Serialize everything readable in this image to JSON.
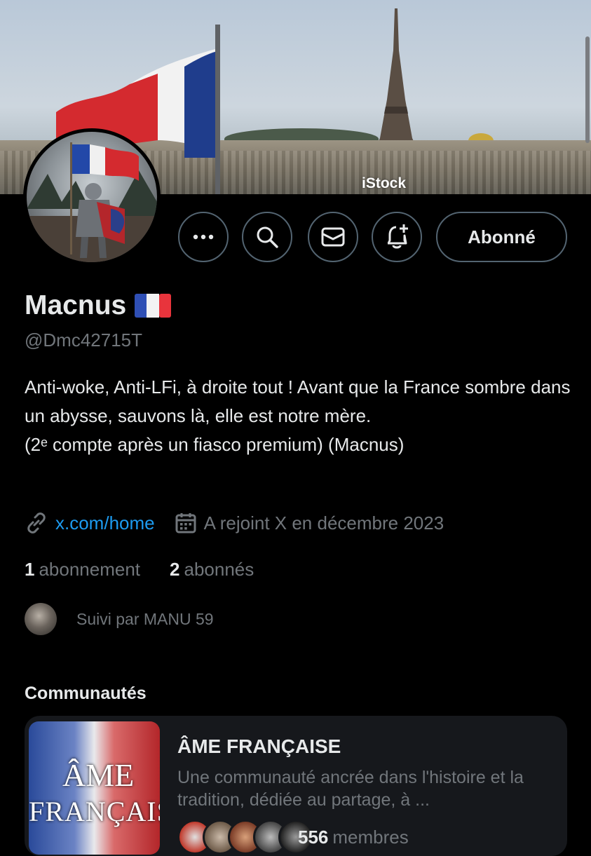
{
  "banner": {
    "watermark": "iStock"
  },
  "actions": {
    "more_icon": "more-icon",
    "search_icon": "search-icon",
    "message_icon": "message-icon",
    "notify_icon": "bell-plus-icon",
    "follow_label": "Abonné"
  },
  "profile": {
    "name": "Macnus",
    "flag_icon": "france-flag-icon",
    "handle": "@Dmc42715T",
    "bio": "Anti-woke, Anti-LFi, à droite tout ! Avant que la France sombre dans un abysse, sauvons là, elle est notre mère.\n(2ᵉ compte après un fiasco premium) (Macnus)",
    "link": "x.com/home",
    "joined": "A rejoint X en décembre 2023",
    "following_count": "1",
    "following_label": "abonnement",
    "followers_count": "2",
    "followers_label": "abonnés",
    "followed_by": "Suivi par MANU 59"
  },
  "communities": {
    "title": "Communautés",
    "items": [
      {
        "image_text_line1": "ÂME",
        "image_text_line2": "FRANÇAISE",
        "name": "ÂME FRANÇAISE",
        "description": "Une communauté ancrée dans l'histoire et la tradition, dédiée au partage, à ...",
        "member_count": "556",
        "member_label": "membres"
      }
    ]
  },
  "colors": {
    "background": "#000000",
    "text_primary": "#e7e9ea",
    "text_secondary": "#71767b",
    "link": "#1d9bf0",
    "border": "#536471",
    "card": "#16181c"
  }
}
